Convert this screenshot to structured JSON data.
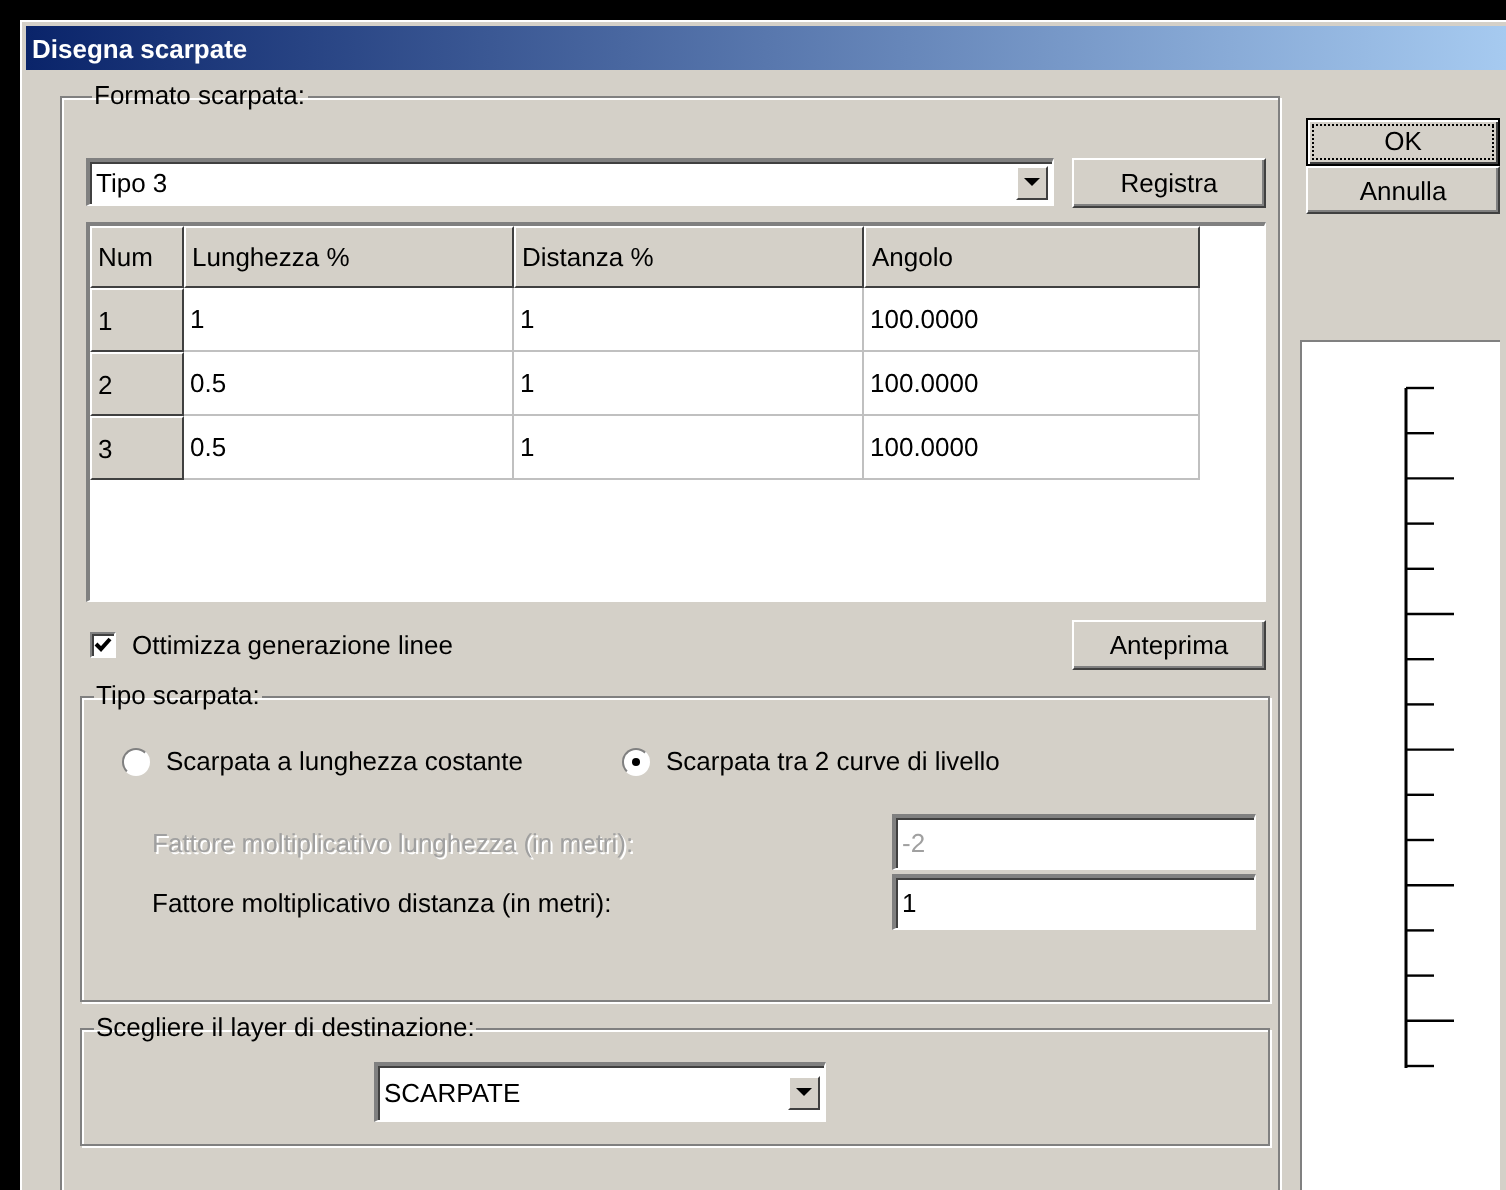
{
  "window": {
    "title": "Disegna scarpate"
  },
  "format_group": {
    "label": "Formato scarpata:",
    "combo": {
      "value": "Tipo 3"
    },
    "save_button": "Registra",
    "table": {
      "columns": [
        "Num",
        "Lunghezza %",
        "Distanza %",
        "Angolo"
      ],
      "rows": [
        [
          "1",
          "1",
          "1",
          "100.0000"
        ],
        [
          "2",
          "0.5",
          "1",
          "100.0000"
        ],
        [
          "3",
          "0.5",
          "1",
          "100.0000"
        ]
      ]
    },
    "optimize": {
      "label": "Ottimizza generazione linee",
      "checked": true
    },
    "preview_button": "Anteprima",
    "type_group": {
      "label": "Tipo scarpata:",
      "options": [
        {
          "label": "Scarpata a lunghezza costante",
          "selected": false
        },
        {
          "label": "Scarpata tra 2 curve di livello",
          "selected": true
        }
      ],
      "fields": [
        {
          "label": "Fattore moltiplicativo lunghezza (in metri):",
          "value": "-2",
          "disabled": true
        },
        {
          "label": "Fattore moltiplicativo distanza (in metri):",
          "value": "1",
          "disabled": false
        }
      ]
    },
    "layer_group": {
      "label": "Scegliere il layer di destinazione:",
      "combo": {
        "value": "SCARPATE"
      }
    }
  },
  "buttons": [
    {
      "label": "OK",
      "default": true
    },
    {
      "label": "Annulla",
      "default": false
    }
  ]
}
